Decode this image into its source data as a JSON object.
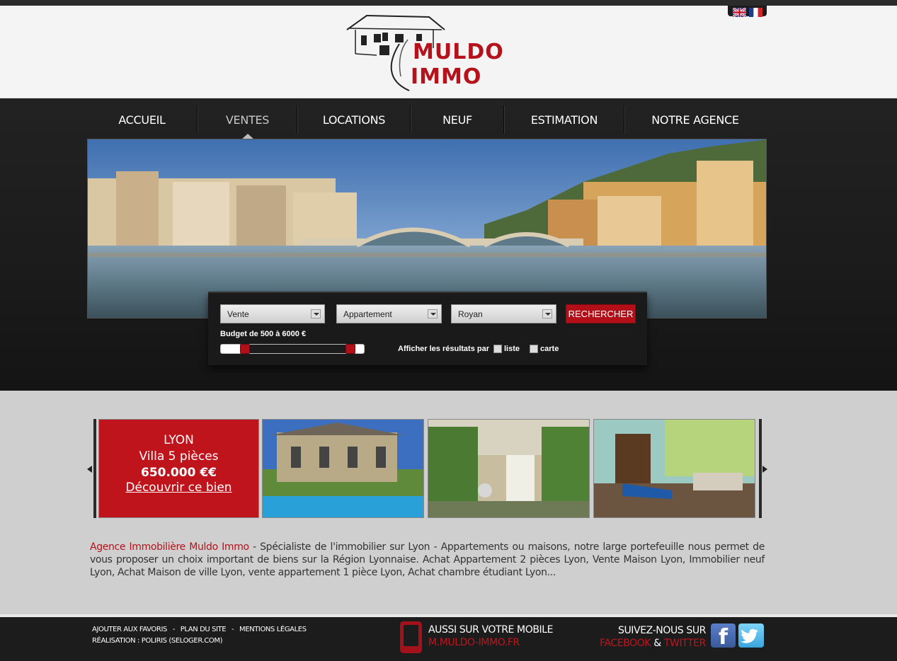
{
  "languages": [
    {
      "code": "en",
      "name": "english-flag-icon"
    },
    {
      "code": "fr",
      "name": "french-flag-icon"
    }
  ],
  "logo": {
    "line1": "MULDO",
    "line2": "IMMO",
    "color": "#b5121b"
  },
  "nav": {
    "items": [
      {
        "label": "ACCUEIL",
        "active": false
      },
      {
        "label": "VENTES",
        "active": true
      },
      {
        "label": "LOCATIONS",
        "active": false
      },
      {
        "label": "NEUF",
        "active": false
      },
      {
        "label": "ESTIMATION",
        "active": false
      },
      {
        "label": "NOTRE AGENCE",
        "active": false
      }
    ]
  },
  "search": {
    "transaction": "Vente",
    "property_type": "Appartement",
    "city": "Royan",
    "submit_label": "RECHERCHER",
    "budget_label": "Budget de 500 à 6000 €",
    "budget_min": 500,
    "budget_max": 6000,
    "results_label": "Afficher les résultats par",
    "option_list": "liste",
    "option_map": "carte"
  },
  "featured": {
    "city": "LYON",
    "type": "Villa 5 pièces",
    "price": "650.000 €€",
    "link": "Découvrir ce bien"
  },
  "description": {
    "highlight": "Agence Immobilière Muldo Immo",
    "text": " - Spécialiste de l'immobilier sur Lyon - Appartements ou maisons, notre large portefeuille nous permet de vous proposer un choix important de biens sur la Région Lyonnaise. Achat Appartement 2 pièces Lyon, Vente Maison Lyon, Immobilier neuf Lyon, Achat Maison de ville Lyon, vente appartement 1 pièce Lyon, Achat chambre étudiant Lyon..."
  },
  "footer": {
    "links": [
      "AJOUTER AUX FAVORIS",
      "PLAN DU SITE",
      "MENTIONS LÉGALES"
    ],
    "separator": "-",
    "credit": "RÉALISATION : POLIRIS (SELOGER.COM)",
    "mobile_title": "AUSSI SUR VOTRE MOBILE",
    "mobile_url": "M.MULDO-IMMO.FR",
    "social_title": "SUIVEZ-NOUS SUR",
    "facebook": "FACEBOOK",
    "amp": "&",
    "twitter": "TWITTER"
  },
  "colors": {
    "accent": "#b5121b",
    "dark": "#1b1b1b",
    "page_bg": "#cfcfcf"
  }
}
